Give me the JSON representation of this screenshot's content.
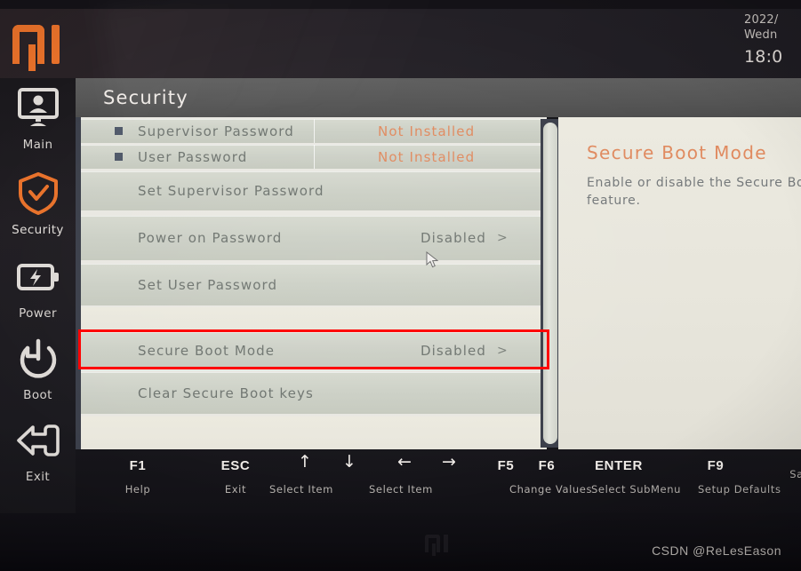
{
  "brand": {
    "logo": "mi-logo",
    "bottom_logo": "mi-logo"
  },
  "topbar": {
    "date": "2022/",
    "weekday": "Wedn",
    "time": "18:0"
  },
  "sidebar": {
    "items": [
      {
        "label": "Main",
        "icon": "monitor-user-icon",
        "active": false
      },
      {
        "label": "Security",
        "icon": "shield-check-icon",
        "active": true
      },
      {
        "label": "Power",
        "icon": "battery-bolt-icon",
        "active": false
      },
      {
        "label": "Boot",
        "icon": "power-refresh-icon",
        "active": false
      },
      {
        "label": "Exit",
        "icon": "exit-arrow-icon",
        "active": false
      }
    ]
  },
  "header": {
    "title": "Security"
  },
  "menu": {
    "rows": [
      {
        "label": "Supervisor Password",
        "value": "Not Installed",
        "value_color": "orange",
        "bullet": true,
        "arrow": ""
      },
      {
        "label": "User Password",
        "value": "Not Installed",
        "value_color": "orange",
        "bullet": true,
        "arrow": ""
      },
      {
        "label": "Set Supervisor Password",
        "value": "",
        "value_color": "gray",
        "bullet": false,
        "arrow": ""
      },
      {
        "label": "Power on Password",
        "value": "Disabled",
        "value_color": "gray",
        "bullet": false,
        "arrow": ">"
      },
      {
        "label": "Set User Password",
        "value": "",
        "value_color": "gray",
        "bullet": false,
        "arrow": ""
      },
      {
        "label": "Secure Boot Mode",
        "value": "Disabled",
        "value_color": "gray",
        "bullet": false,
        "arrow": ">"
      },
      {
        "label": "Clear Secure Boot keys",
        "value": "",
        "value_color": "gray",
        "bullet": false,
        "arrow": ""
      }
    ],
    "highlighted_row": "Secure Boot Mode",
    "highlight_color": "#fe0000"
  },
  "help": {
    "title": "Secure Boot Mode",
    "body": "Enable or disable the Secure Boot feature."
  },
  "fkeys": [
    {
      "key": "F1",
      "desc": "Help",
      "icon": ""
    },
    {
      "key": "ESC",
      "desc": "Exit",
      "icon": ""
    },
    {
      "key": "↑",
      "desc": "Select Item",
      "icon": "arrow-up-icon"
    },
    {
      "key": "↓",
      "desc": "",
      "icon": "arrow-down-icon"
    },
    {
      "key": "←",
      "desc": "Select Item",
      "icon": "arrow-left-icon"
    },
    {
      "key": "→",
      "desc": "",
      "icon": "arrow-right-icon"
    },
    {
      "key": "F5",
      "desc": "Change Values",
      "icon": ""
    },
    {
      "key": "F6",
      "desc": "",
      "icon": ""
    },
    {
      "key": "ENTER",
      "desc": "Select SubMenu",
      "icon": ""
    },
    {
      "key": "F9",
      "desc": "Setup Defaults",
      "icon": ""
    },
    {
      "key": "",
      "desc": "Sa",
      "icon": ""
    }
  ],
  "watermark": {
    "text": "CSDN @ReLesEason"
  },
  "colors": {
    "accent_orange": "#e8712a",
    "value_orange": "#e08a5f",
    "highlight_red": "#fe0000",
    "panel_bg": "#e9e8e2",
    "row_bg": "#ccd0c6"
  }
}
